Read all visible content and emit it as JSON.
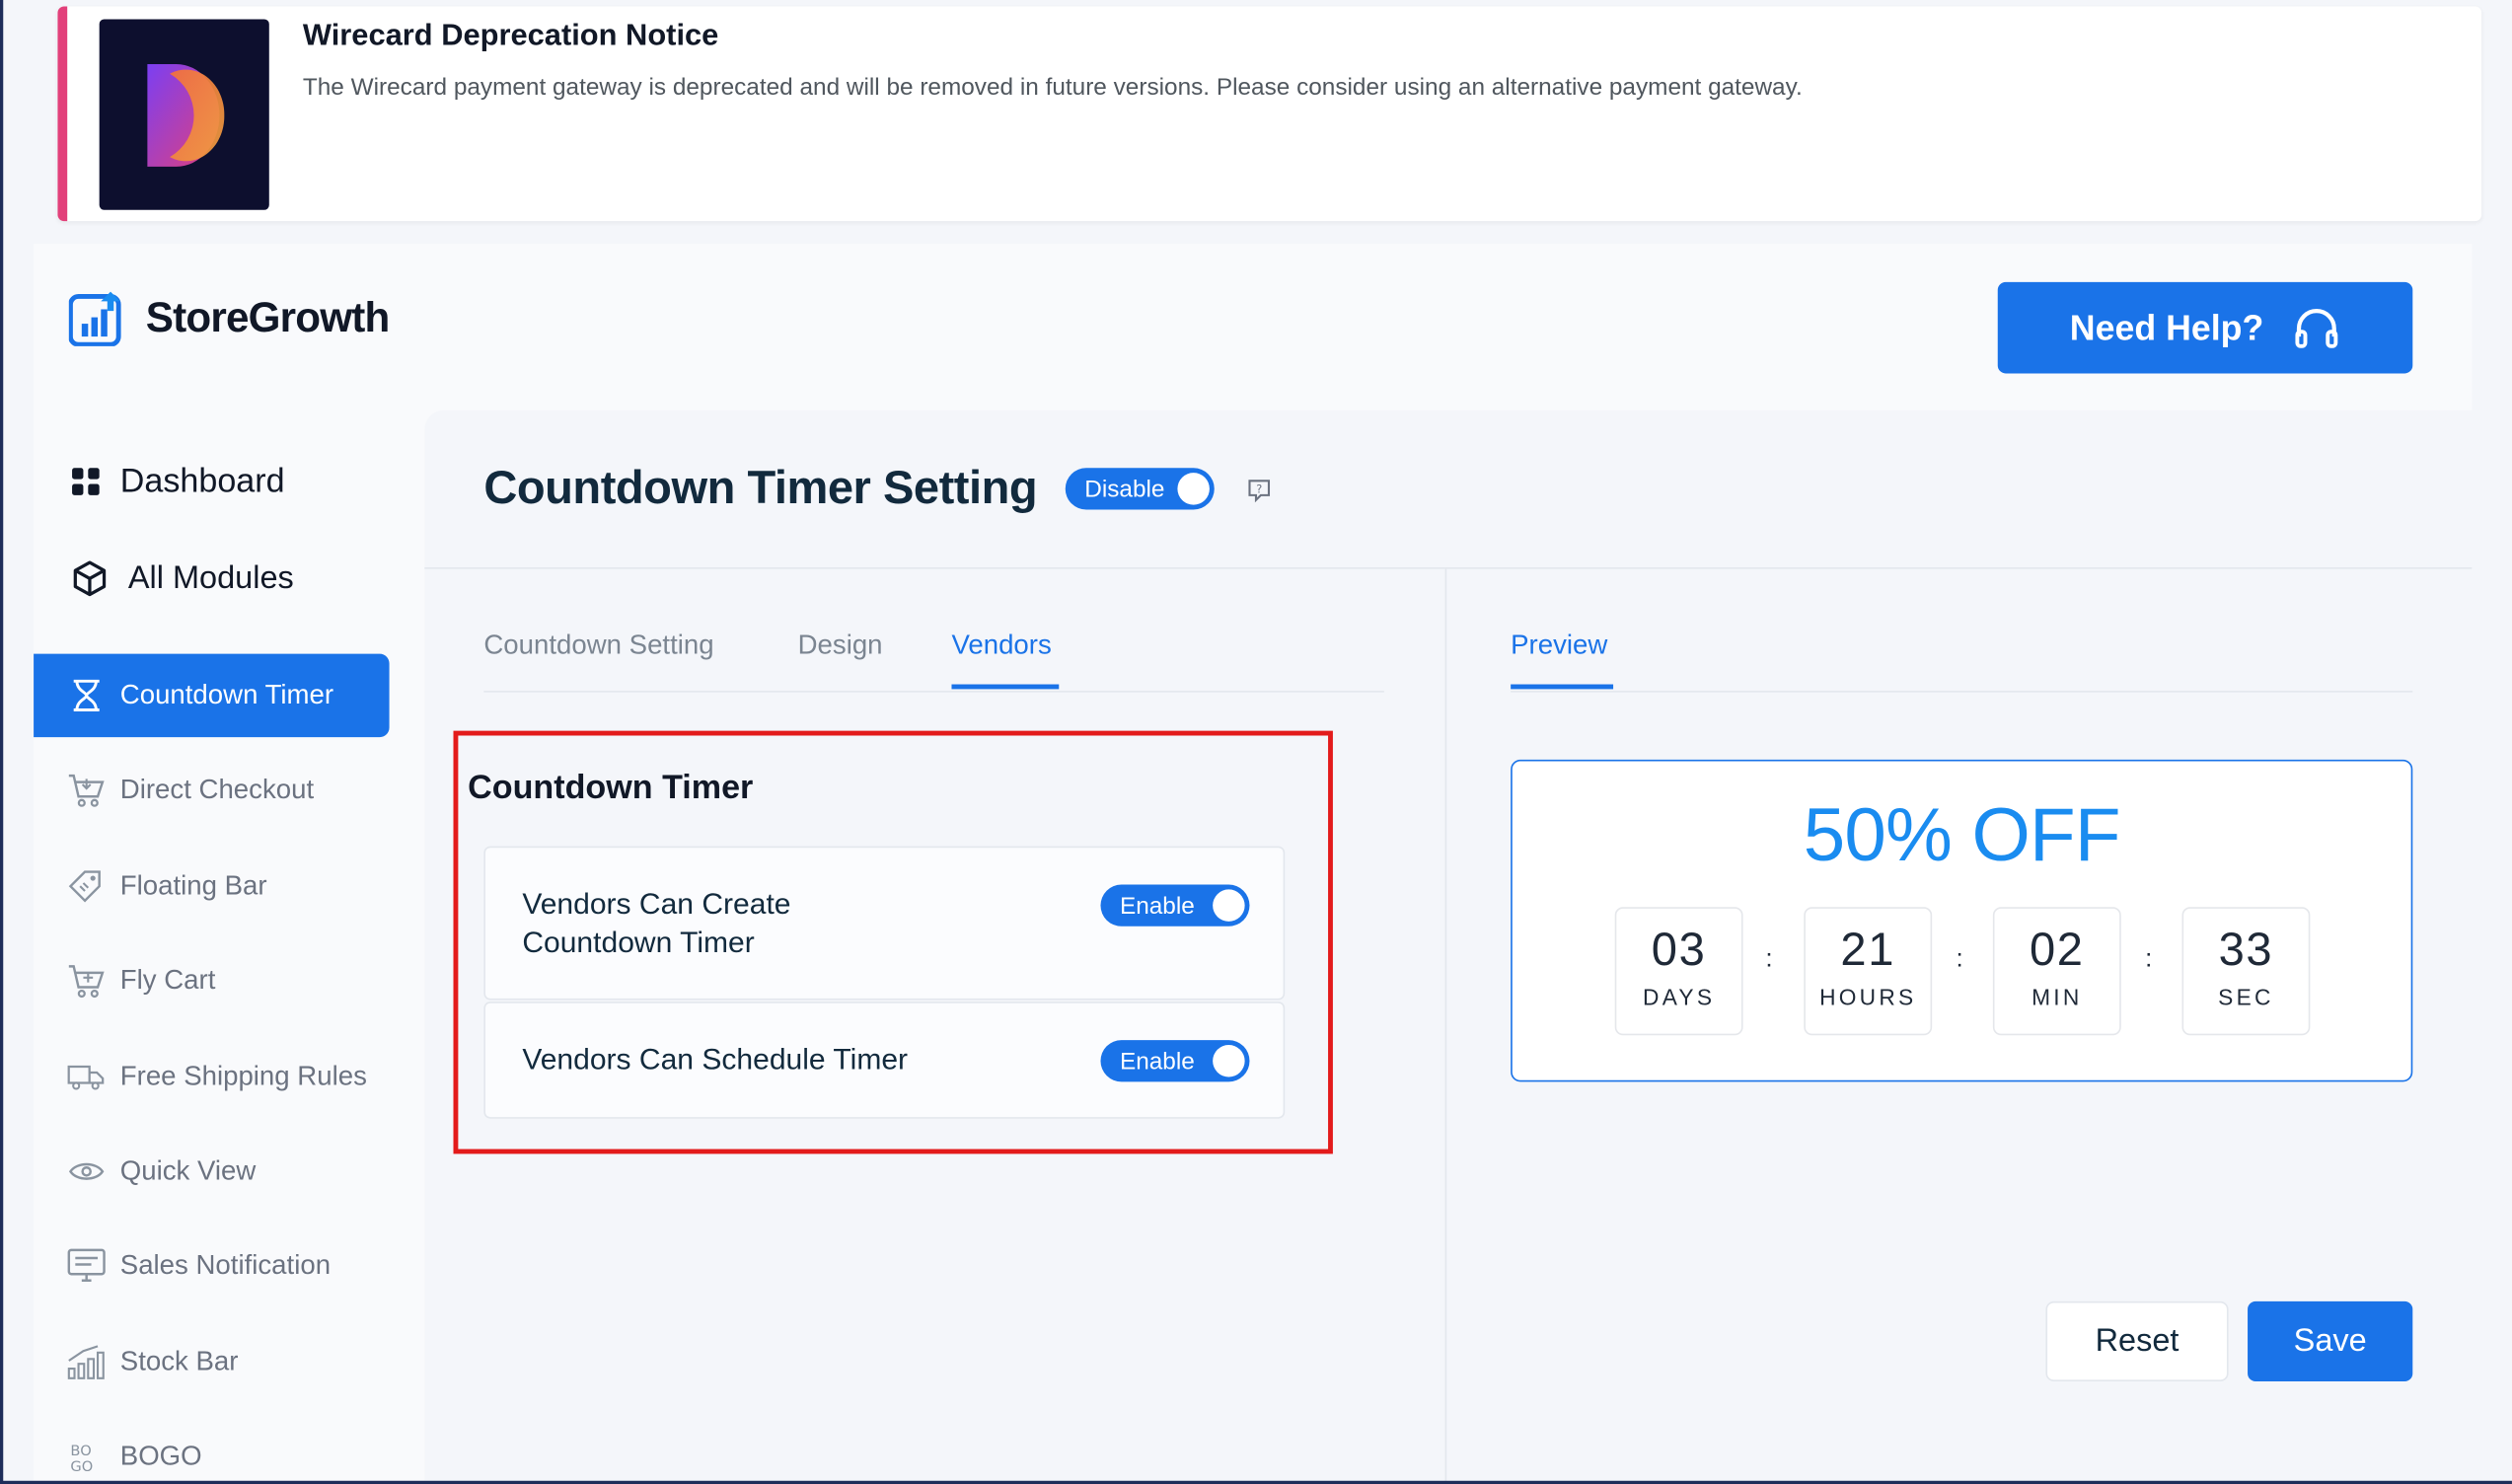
{
  "notice": {
    "title": "Wirecard Deprecation Notice",
    "text": "The Wirecard payment gateway is deprecated and will be removed in future versions. Please consider using an alternative payment gateway."
  },
  "brand": {
    "name": "StoreGrowth"
  },
  "header": {
    "help_label": "Need Help?"
  },
  "sidebar": {
    "items": [
      {
        "label": "Dashboard",
        "icon": "grid-icon"
      },
      {
        "label": "All Modules",
        "icon": "cube-icon"
      },
      {
        "label": "Countdown Timer",
        "icon": "hourglass-icon",
        "active": true
      },
      {
        "label": "Direct Checkout",
        "icon": "cart-icon"
      },
      {
        "label": "Floating Bar",
        "icon": "tag-icon"
      },
      {
        "label": "Fly Cart",
        "icon": "cart-icon"
      },
      {
        "label": "Free Shipping Rules",
        "icon": "truck-icon"
      },
      {
        "label": "Quick View",
        "icon": "eye-icon"
      },
      {
        "label": "Sales Notification",
        "icon": "monitor-icon"
      },
      {
        "label": "Stock Bar",
        "icon": "bar-chart-icon"
      },
      {
        "label": "BOGO",
        "icon": "bogo-icon"
      }
    ]
  },
  "page": {
    "title": "Countdown Timer Setting",
    "status_toggle": "Disable"
  },
  "tabs": {
    "items": [
      "Countdown Setting",
      "Design",
      "Vendors"
    ],
    "active": "Vendors"
  },
  "section": {
    "title": "Countdown Timer",
    "settings": [
      {
        "label_line1": "Vendors Can Create",
        "label_line2": "Countdown Timer",
        "toggle": "Enable"
      },
      {
        "label_line1": "Vendors Can Schedule Timer",
        "toggle": "Enable"
      }
    ]
  },
  "preview": {
    "tab": "Preview",
    "offer": "50% OFF",
    "units": [
      {
        "value": "03",
        "caption": "DAYS"
      },
      {
        "value": "21",
        "caption": "HOURS"
      },
      {
        "value": "02",
        "caption": "MIN"
      },
      {
        "value": "33",
        "caption": "SEC"
      }
    ],
    "separator": ":"
  },
  "actions": {
    "reset": "Reset",
    "save": "Save"
  },
  "colors": {
    "accent": "#1a73e8",
    "notice_accent": "#e2407a",
    "highlight": "#e31b1b",
    "offer": "#1a8cf0"
  }
}
